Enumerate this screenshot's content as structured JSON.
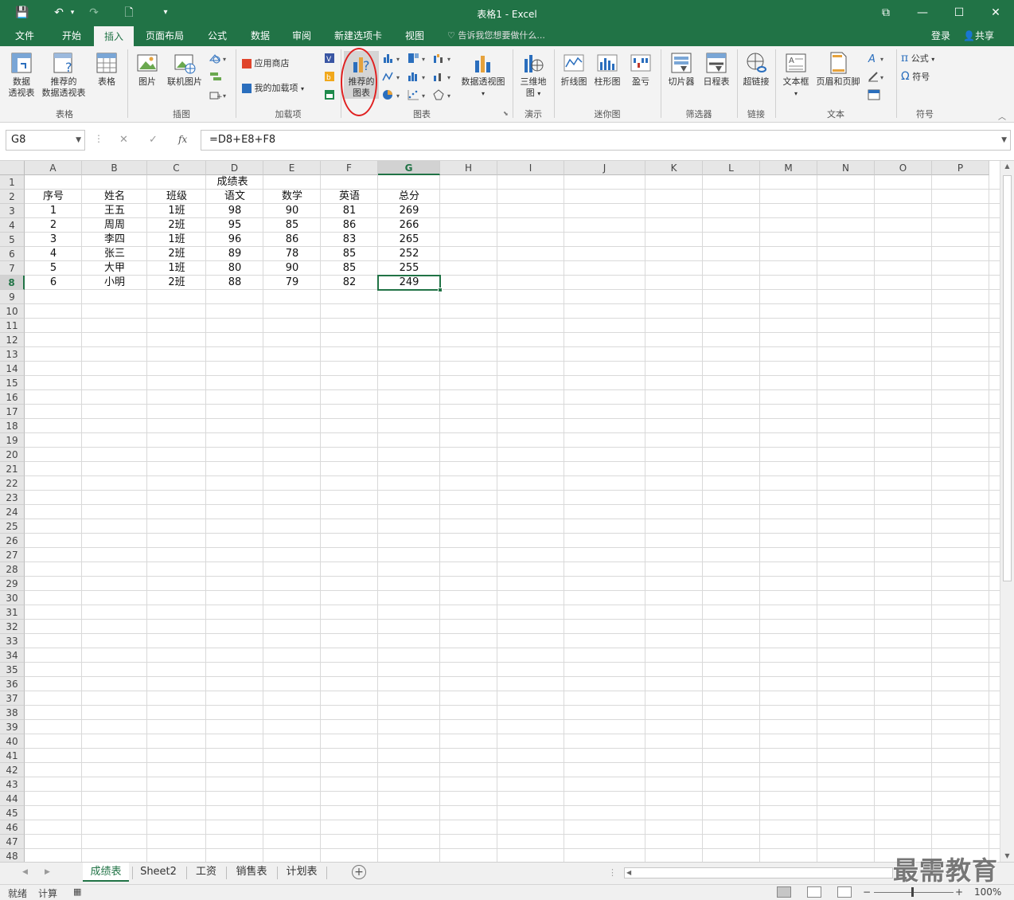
{
  "window": {
    "title": "表格1 - Excel"
  },
  "qat": {
    "save": "💾",
    "undo": "↶",
    "redo": "↷",
    "new": "🗋",
    "more": "▾"
  },
  "tabs": [
    {
      "label": "文件"
    },
    {
      "label": "开始"
    },
    {
      "label": "插入"
    },
    {
      "label": "页面布局"
    },
    {
      "label": "公式"
    },
    {
      "label": "数据"
    },
    {
      "label": "审阅"
    },
    {
      "label": "新建选项卡"
    },
    {
      "label": "视图"
    }
  ],
  "active_tab": "插入",
  "tellme": {
    "placeholder": "告诉我您想要做什么..."
  },
  "account": {
    "login": "登录",
    "share": "共享"
  },
  "ribbon": {
    "groups": {
      "table": "表格",
      "illustrations": "插图",
      "addins": "加载项",
      "charts": "图表",
      "tours": "演示",
      "sparklines": "迷你图",
      "filters": "筛选器",
      "links": "链接",
      "text": "文本",
      "symbols": "符号"
    },
    "buttons": {
      "pivot_line1": "数据",
      "pivot_line2": "透视表",
      "rec_pivot_line1": "推荐的",
      "rec_pivot_line2": "数据透视表",
      "table": "表格",
      "picture": "图片",
      "online_picture": "联机图片",
      "store": "应用商店",
      "my_addins": "我的加载项",
      "rec_chart_line1": "推荐的",
      "rec_chart_line2": "图表",
      "pivot_chart": "数据透视图",
      "map3d_line1": "三维地",
      "map3d_line2": "图",
      "line": "折线图",
      "column": "柱形图",
      "winloss": "盈亏",
      "slicer": "切片器",
      "timeline": "日程表",
      "hyperlink": "超链接",
      "textbox": "文本框",
      "header_footer": "页眉和页脚",
      "equation": "公式",
      "symbol": "符号"
    }
  },
  "namebox": {
    "value": "G8"
  },
  "formula": {
    "value": "=D8+E8+F8"
  },
  "columns": [
    "A",
    "B",
    "C",
    "D",
    "E",
    "F",
    "G",
    "H",
    "I",
    "J",
    "K",
    "L",
    "M",
    "N",
    "O",
    "P"
  ],
  "selected_column": "G",
  "selected_row": 8,
  "rows_visible": 48,
  "sheet": {
    "title": "成绩表",
    "headers": [
      "序号",
      "姓名",
      "班级",
      "语文",
      "数学",
      "英语",
      "总分"
    ],
    "rows": [
      [
        "1",
        "王五",
        "1班",
        "98",
        "90",
        "81",
        "269"
      ],
      [
        "2",
        "周周",
        "2班",
        "95",
        "85",
        "86",
        "266"
      ],
      [
        "3",
        "李四",
        "1班",
        "96",
        "86",
        "83",
        "265"
      ],
      [
        "4",
        "张三",
        "2班",
        "89",
        "78",
        "85",
        "252"
      ],
      [
        "5",
        "大甲",
        "1班",
        "80",
        "90",
        "85",
        "255"
      ],
      [
        "6",
        "小明",
        "2班",
        "88",
        "79",
        "82",
        "249"
      ]
    ]
  },
  "sheet_tabs": [
    "成绩表",
    "Sheet2",
    "工资",
    "销售表",
    "计划表"
  ],
  "active_sheet": "成绩表",
  "status": {
    "ready": "就绪",
    "calc": "计算",
    "zoom": "100%"
  },
  "watermark": "最需教育",
  "colors": {
    "accent": "#217346",
    "highlight": "#e02020"
  }
}
